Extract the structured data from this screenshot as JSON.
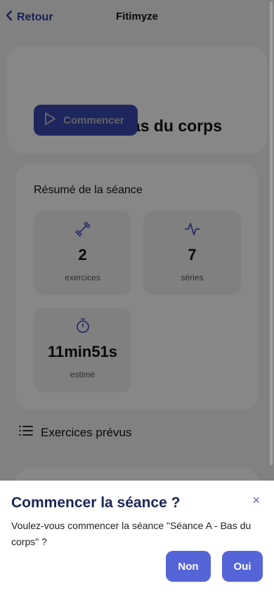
{
  "header": {
    "back_label": "Retour",
    "app_title": "Fitimyze"
  },
  "session": {
    "title": "Séance A - Bas du corps",
    "start_label": "Commencer"
  },
  "summary": {
    "title": "Résumé de la séance",
    "stats": [
      {
        "icon": "dumbbell-icon",
        "value": "2",
        "label": "exercices"
      },
      {
        "icon": "activity-icon",
        "value": "7",
        "label": "séries"
      },
      {
        "icon": "stopwatch-icon",
        "value": "11min51s",
        "label": "estimé"
      }
    ]
  },
  "exercises": {
    "title": "Exercices prévus"
  },
  "dialog": {
    "title": "Commencer la séance ?",
    "close": "×",
    "message": "Voulez-vous commencer la séance \"Séance A - Bas du corps\" ?",
    "no_label": "Non",
    "yes_label": "Oui"
  },
  "colors": {
    "primary": "#3848b0",
    "dialog_button": "#5565d8",
    "title_dark": "#1b2657",
    "overlay": "#000000"
  }
}
